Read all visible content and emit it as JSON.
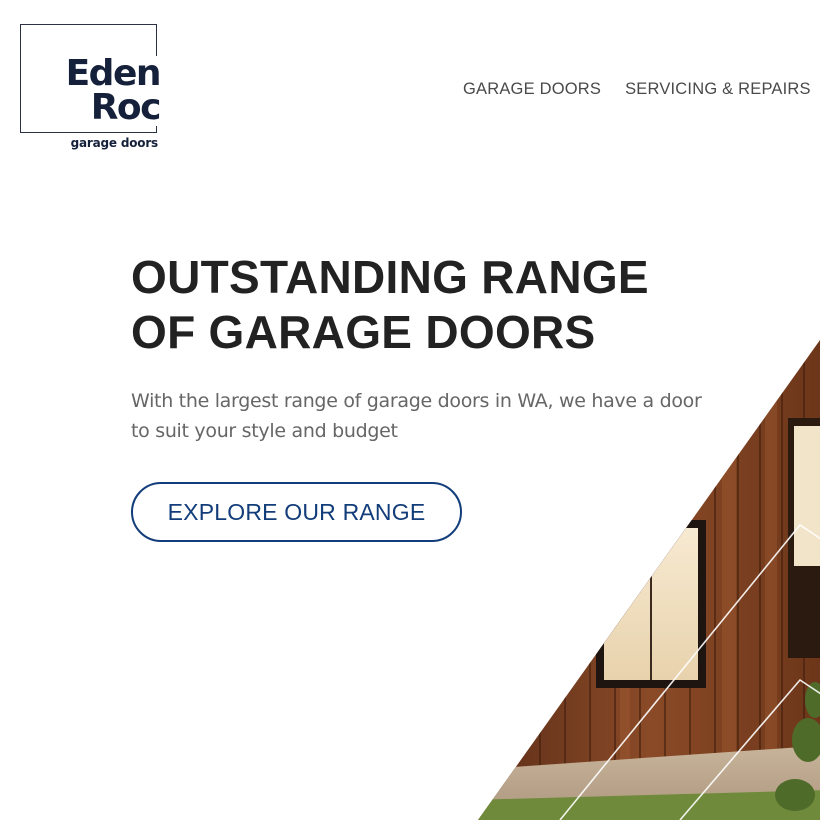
{
  "brand": {
    "name_line1": "Eden",
    "name_line2": "Roc",
    "tagline": "garage doors",
    "navy": "#15203b"
  },
  "nav": {
    "items": [
      {
        "label": "GARAGE DOORS"
      },
      {
        "label": "SERVICING & REPAIRS"
      }
    ]
  },
  "hero": {
    "title_line1": "OUTSTANDING RANGE",
    "title_line2": "OF GARAGE DOORS",
    "subtitle": "With the largest range of garage doors in WA, we have a door to suit your style and budget",
    "cta_label": "EXPLORE OUR RANGE",
    "accent": "#123d7a"
  },
  "image": {
    "subject": "timber-clad-house-photo"
  }
}
